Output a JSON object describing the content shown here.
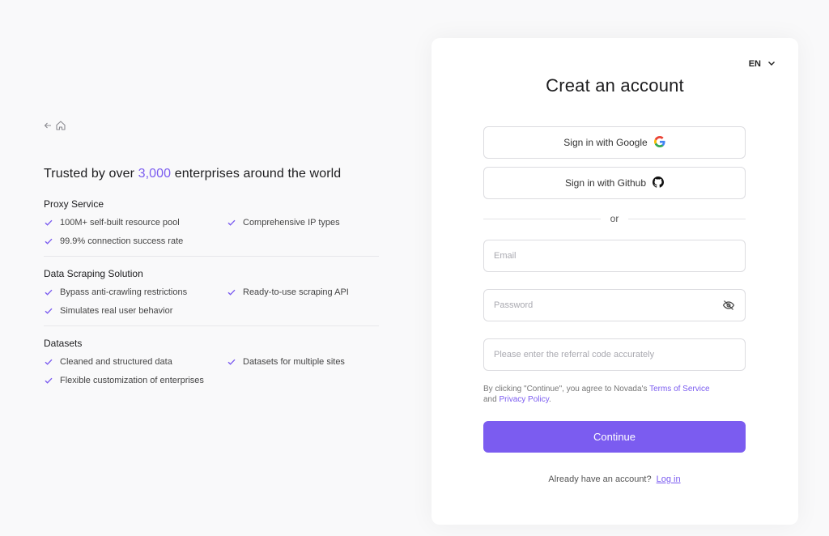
{
  "nav": {
    "back_icon": "arrow-left-icon",
    "home_icon": "home-icon"
  },
  "headline": {
    "prefix": "Trusted by over ",
    "highlight": "3,000",
    "suffix": " enterprises around the world"
  },
  "sections": [
    {
      "title": "Proxy Service",
      "features": [
        "100M+ self-built resource pool",
        "Comprehensive IP types",
        "99.9% connection success rate"
      ]
    },
    {
      "title": "Data Scraping Solution",
      "features": [
        "Bypass anti-crawling restrictions",
        "Ready-to-use scraping API",
        "Simulates real user behavior"
      ]
    },
    {
      "title": "Datasets",
      "features": [
        "Cleaned and structured data",
        "Datasets for multiple sites",
        "Flexible customization of enterprises"
      ]
    }
  ],
  "card": {
    "language": "EN",
    "title": "Creat an account",
    "google_label": "Sign in with Google",
    "github_label": "Sign in with Github",
    "divider_text": "or",
    "email_placeholder": "Email",
    "password_placeholder": "Password",
    "referral_placeholder": "Please enter the referral code accurately",
    "terms_prefix": "By clicking \"Continue\", you agree to Novada's ",
    "terms_link": "Terms of Service",
    "terms_and": " and ",
    "privacy_link": "Privacy Policy",
    "terms_suffix": ".",
    "continue_label": "Continue",
    "already_text": "Already have an account?",
    "login_link": "Log in"
  },
  "colors": {
    "accent": "#7b5cf0",
    "background": "#f9f9fa",
    "card": "#ffffff"
  }
}
